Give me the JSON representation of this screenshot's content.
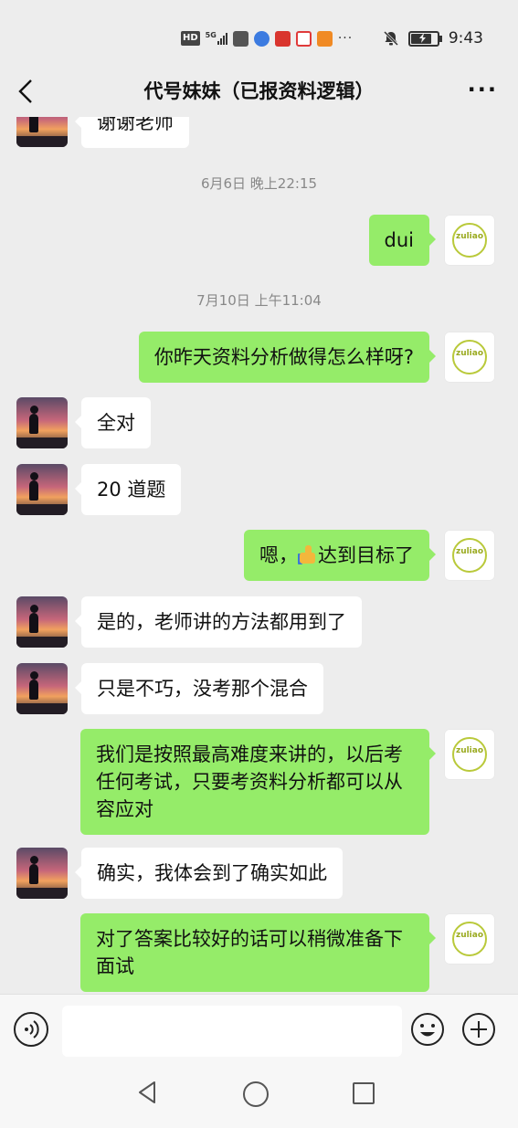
{
  "status_bar": {
    "time": "9:43",
    "hd_label": "HD",
    "network_label": "5G",
    "overflow": "···",
    "battery_level": 0.85
  },
  "header": {
    "title": "代号妹妹（已报资料逻辑）",
    "more": "···"
  },
  "messages": [
    {
      "side": "left",
      "text": "谢谢老师"
    },
    {
      "type": "time",
      "text": "6月6日 晚上22:15"
    },
    {
      "side": "right",
      "text": "dui"
    },
    {
      "type": "time",
      "text": "7月10日 上午11:04"
    },
    {
      "side": "right",
      "text": "你昨天资料分析做得怎么样呀?"
    },
    {
      "side": "left",
      "text": "全对"
    },
    {
      "side": "left",
      "text": "20 道题"
    },
    {
      "side": "right",
      "text_before": "嗯，",
      "emoji": "thumbs-up",
      "text_after": "达到目标了"
    },
    {
      "side": "left",
      "text": "是的，老师讲的方法都用到了"
    },
    {
      "side": "left",
      "text": "只是不巧，没考那个混合"
    },
    {
      "side": "right",
      "text": "我们是按照最高难度来讲的，以后考任何考试，只要考资料分析都可以从容应对"
    },
    {
      "side": "left",
      "text": "确实，我体会到了确实如此"
    },
    {
      "side": "right",
      "text": "对了答案比较好的话可以稍微准备下面试"
    }
  ],
  "my_avatar_text": "zuliao",
  "input": {
    "placeholder": "",
    "value": ""
  },
  "colors": {
    "background": "#ededed",
    "my_bubble": "#95ec69",
    "their_bubble": "#ffffff"
  }
}
